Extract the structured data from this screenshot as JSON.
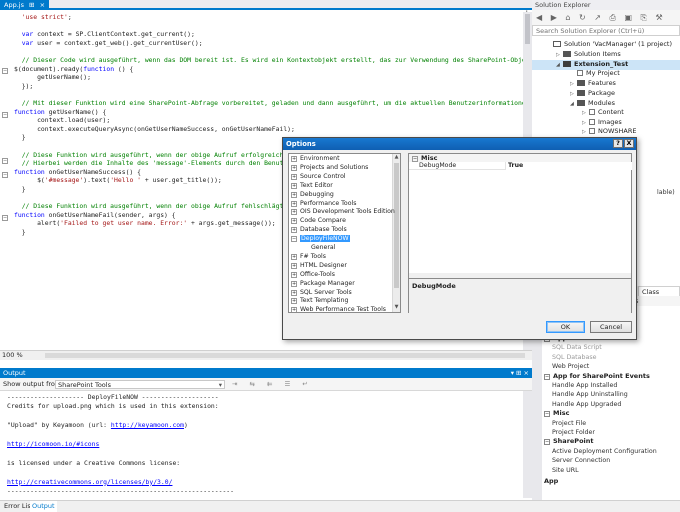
{
  "editor": {
    "tab_label": "App.js",
    "tab_pin": "⊞",
    "tab_close": "×",
    "add_label": "+",
    "zoom": "100 %",
    "lines": [
      "  'use strict';",
      "",
      "  var context = SP.ClientContext.get_current();",
      "  var user = context.get_web().get_currentUser();",
      "",
      "  // Dieser Code wird ausgeführt, wenn das DOM bereit ist. Es wird ein Kontextobjekt erstellt, das zur Verwendung des SharePoint-Objekt",
      "$(document).ready(function () {",
      "      getUserName();",
      "  });",
      "",
      "  // Mit dieser Funktion wird eine SharePoint-Abfrage vorbereitet, geladen und dann ausgeführt, um die aktuellen Benutzerinformationen",
      "function getUserName() {",
      "      context.load(user);",
      "      context.executeQueryAsync(onGetUserNameSuccess, onGetUserNameFail);",
      "  }",
      "",
      "  // Diese Funktion wird ausgeführt, wenn der obige Aufruf erfolgreich",
      "  // Hierbei werden die Inhalte des 'message'-Elements durch den Benut",
      "function onGetUserNameSuccess() {",
      "      $('#message').text('Hello ' + user.get_title());",
      "  }",
      "",
      "  // Diese Funktion wird ausgeführt, wenn der obige Aufruf fehlschlägt",
      "function onGetUserNameFail(sender, args) {",
      "      alert('Failed to get user name. Error:' + args.get_message());",
      "  }"
    ]
  },
  "output": {
    "title": "Output",
    "title_controls": "▾ ⊞ ×",
    "show_from_label": "Show output from:",
    "source": "SharePoint Tools",
    "toolbar_icons": "⇥ ⇆ ⇇ ☰ ↵",
    "lines": [
      "-------------------- DeployFileNOW --------------------",
      "Credits for upload.png which is used in this extension:",
      "",
      "\"Upload\" by Keyamoon (url: http://keyamoon.com)",
      "",
      "http://icomoon.io/#icons",
      "",
      "is licensed under a Creative Commons license:",
      "",
      "http://creativecommons.org/licenses/by/3.0/",
      "-----------------------------------------------------------"
    ],
    "links": {
      "keyamoon": "http://keyamoon.com",
      "icomoon": "http://icomoon.io/#icons",
      "cc": "http://creativecommons.org/licenses/by/3.0/"
    }
  },
  "bottom_tabs": [
    "Error List",
    "Output"
  ],
  "solution_explorer": {
    "title": "Solution Explorer",
    "toolbar_icons": "◀ ▶ ⌂ ↻ ↗ ⎙ ▣ ⎘ ⚒ ▷",
    "search_placeholder": "Search Solution Explorer (Ctrl+ü)",
    "nodes": [
      {
        "label": "Solution 'VacManager' (1 project)",
        "icon": "solution-icon"
      },
      {
        "label": "Solution Items",
        "icon": "folder-icon"
      },
      {
        "label": "Extension_Test",
        "icon": "project-icon"
      },
      {
        "label": "My Project",
        "icon": "wrench-icon"
      },
      {
        "label": "Features",
        "icon": "folder-icon"
      },
      {
        "label": "Package",
        "icon": "package-icon"
      },
      {
        "label": "Modules",
        "icon": "folder-icon"
      },
      {
        "label": "Content",
        "icon": "module-icon"
      },
      {
        "label": "Images",
        "icon": "module-icon"
      },
      {
        "label": "NOWSHARE",
        "icon": "module-icon"
      }
    ],
    "partial_right": "lable)",
    "class_view_tab": "Class View",
    "props_partial": "ties"
  },
  "app_list": {
    "items_top": [
      {
        "label": "App",
        "type": "head"
      },
      {
        "label": "SQL Data Script",
        "type": "dim"
      },
      {
        "label": "SQL Database",
        "type": "dim"
      },
      {
        "label": "Web Project",
        "type": "item"
      }
    ],
    "groups": [
      {
        "label": "App for SharePoint Events",
        "items": [
          "Handle App Installed",
          "Handle App Uninstalling",
          "Handle App Upgraded"
        ]
      },
      {
        "label": "Misc",
        "items": [
          "Project File",
          "Project Folder"
        ]
      },
      {
        "label": "SharePoint",
        "items": [
          "Active Deployment Configuration",
          "Server Connection",
          "Site URL"
        ]
      }
    ],
    "footer": "App"
  },
  "dialog": {
    "title": "Options",
    "help": "?",
    "close": "X",
    "tree": [
      {
        "label": "Environment",
        "child": false
      },
      {
        "label": "Projects and Solutions",
        "child": false
      },
      {
        "label": "Source Control",
        "child": false
      },
      {
        "label": "Text Editor",
        "child": false
      },
      {
        "label": "Debugging",
        "child": false
      },
      {
        "label": "Performance Tools",
        "child": false
      },
      {
        "label": "OIS Development Tools Edition",
        "child": false
      },
      {
        "label": "Code Compare",
        "child": false
      },
      {
        "label": "Database Tools",
        "child": false
      },
      {
        "label": "DeployFileNOW",
        "child": false,
        "selected": true,
        "expanded": true
      },
      {
        "label": "General",
        "child": true
      },
      {
        "label": "F# Tools",
        "child": false
      },
      {
        "label": "HTML Designer",
        "child": false
      },
      {
        "label": "Office-Tools",
        "child": false
      },
      {
        "label": "Package Manager",
        "child": false
      },
      {
        "label": "SQL Server Tools",
        "child": false
      },
      {
        "label": "Text Templating",
        "child": false
      },
      {
        "label": "Web Performance Test Tools",
        "child": false
      }
    ],
    "category": "Misc",
    "property_key": "DebugMode",
    "property_value": "True",
    "description_title": "DebugMode",
    "ok": "OK",
    "cancel": "Cancel"
  }
}
